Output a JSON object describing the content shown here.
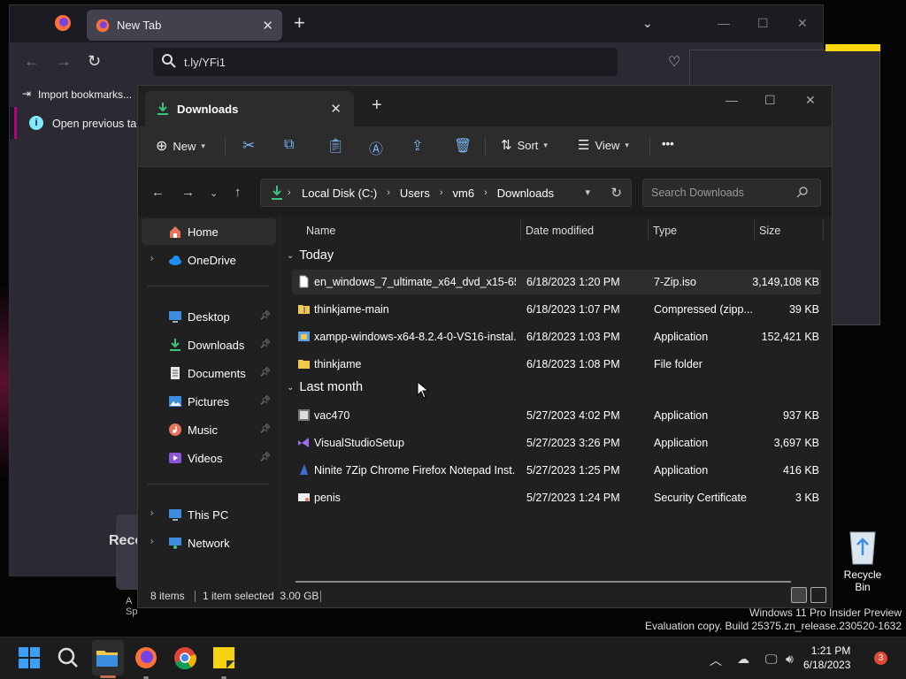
{
  "firefox": {
    "tab_title": "New Tab",
    "url": "t.ly/YFi1",
    "bookmark_import": "Import bookmarks...",
    "infobar_text": "Open previous tabs",
    "recent_heading": "Reco",
    "tile_label_1": "A",
    "tile_label_2": "Sp"
  },
  "explorer": {
    "tab_title": "Downloads",
    "commands": {
      "new": "New",
      "sort": "Sort",
      "view": "View",
      "more": "•••"
    },
    "breadcrumb": [
      "Local Disk (C:)",
      "Users",
      "vm6",
      "Downloads"
    ],
    "search_placeholder": "Search Downloads",
    "nav": {
      "home": "Home",
      "onedrive": "OneDrive",
      "desktop": "Desktop",
      "downloads": "Downloads",
      "documents": "Documents",
      "pictures": "Pictures",
      "music": "Music",
      "videos": "Videos",
      "thispc": "This PC",
      "network": "Network"
    },
    "columns": {
      "name": "Name",
      "date": "Date modified",
      "type": "Type",
      "size": "Size"
    },
    "groups": {
      "today": "Today",
      "last_month": "Last month"
    },
    "files_today": [
      {
        "name": "en_windows_7_ultimate_x64_dvd_x15-65...",
        "date": "6/18/2023 1:20 PM",
        "type": "7-Zip.iso",
        "size": "3,149,108 KB",
        "icon": "file-icon"
      },
      {
        "name": "thinkjame-main",
        "date": "6/18/2023 1:07 PM",
        "type": "Compressed (zipp...",
        "size": "39 KB",
        "icon": "zip-folder-icon"
      },
      {
        "name": "xampp-windows-x64-8.2.4-0-VS16-instal...",
        "date": "6/18/2023 1:03 PM",
        "type": "Application",
        "size": "152,421 KB",
        "icon": "installer-icon"
      },
      {
        "name": "thinkjame",
        "date": "6/18/2023 1:08 PM",
        "type": "File folder",
        "size": "",
        "icon": "folder-icon"
      }
    ],
    "files_last_month": [
      {
        "name": "vac470",
        "date": "5/27/2023 4:02 PM",
        "type": "Application",
        "size": "937 KB",
        "icon": "app-icon"
      },
      {
        "name": "VisualStudioSetup",
        "date": "5/27/2023 3:26 PM",
        "type": "Application",
        "size": "3,697 KB",
        "icon": "visual-studio-icon"
      },
      {
        "name": "Ninite 7Zip Chrome Firefox Notepad Inst...",
        "date": "5/27/2023 1:25 PM",
        "type": "Application",
        "size": "416 KB",
        "icon": "ninite-icon"
      },
      {
        "name": "penis",
        "date": "5/27/2023 1:24 PM",
        "type": "Security Certificate",
        "size": "3 KB",
        "icon": "certificate-icon"
      }
    ],
    "status": {
      "items": "8 items",
      "selected": "1 item selected  3.00 GB"
    }
  },
  "desktop": {
    "recycle_bin": "Recycle Bin",
    "watermark_line1": "Windows 11 Pro Insider Preview",
    "watermark_line2": "Evaluation copy. Build 25375.zn_release.230520-1632"
  },
  "taskbar": {
    "time": "1:21 PM",
    "date": "6/18/2023",
    "notifications": "3"
  },
  "colors": {
    "accent_green": "#3cc47c",
    "folder_yellow": "#f2c84b",
    "firefox_magenta": "#b5007f"
  }
}
